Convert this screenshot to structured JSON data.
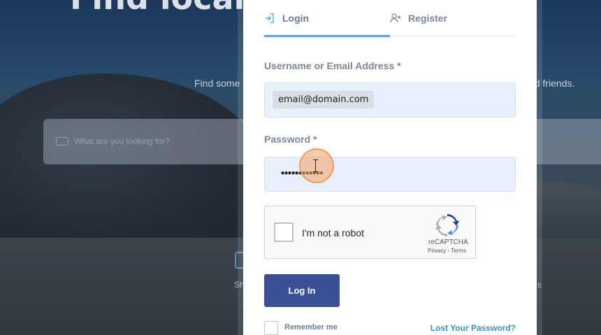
{
  "background": {
    "hero_title": "Find local b                       a Bra",
    "hero_subtitle_left": "Find some",
    "hero_subtitle_right": "nd friends.",
    "search_placeholder": "What are you looking for?",
    "category_left_label": "Sh",
    "category_right_label": "es"
  },
  "modal": {
    "tabs": [
      {
        "label": "Login",
        "icon": "login-icon",
        "active": true
      },
      {
        "label": "Register",
        "icon": "add-user-icon",
        "active": false
      }
    ],
    "username": {
      "label": "Username or Email Address *",
      "value": "email@domain.com"
    },
    "password": {
      "label": "Password *",
      "value": "••••••••••••"
    },
    "recaptcha": {
      "text": "I'm not a robot",
      "brand": "reCAPTCHA",
      "links": "Privacy - Terms"
    },
    "login_button": "Log In",
    "remember_me": "Remember me",
    "lost_password": "Lost Your Password?"
  },
  "colors": {
    "accent_tab": "#5aa6e2",
    "button": "#3b4f96",
    "link": "#3592d3",
    "input_bg": "#e8f0fe"
  }
}
